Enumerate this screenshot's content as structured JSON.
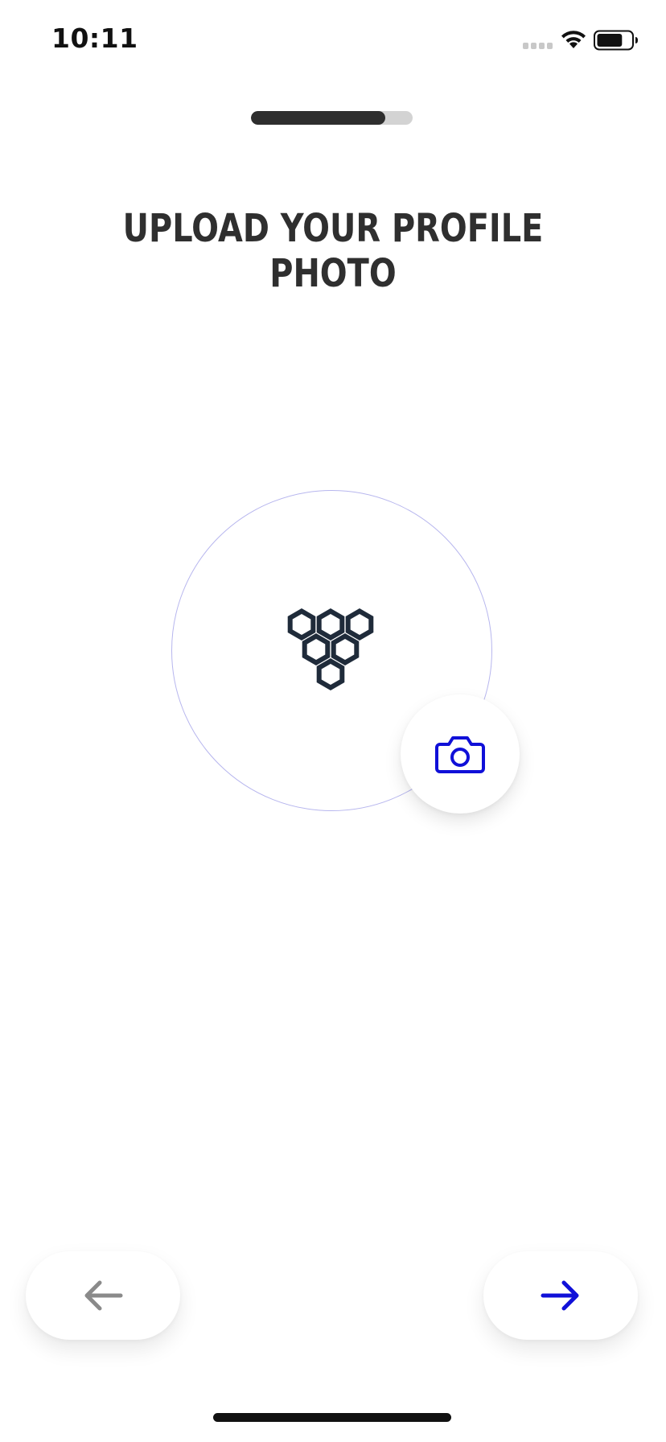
{
  "status_bar": {
    "time": "10:11",
    "signal_icon": "cellular-dots-icon",
    "wifi_icon": "wifi-icon",
    "battery_icon": "battery-icon",
    "battery_level": 0.75
  },
  "progress": {
    "value": 0.83,
    "fill_color": "#2e2e2e",
    "track_color": "#d3d3d3"
  },
  "title": "UPLOAD YOUR PROFILE PHOTO",
  "photo": {
    "placeholder_icon": "honeycomb-logo-icon",
    "camera_icon": "camera-icon"
  },
  "navigation": {
    "back_icon": "arrow-left-icon",
    "next_icon": "arrow-right-icon",
    "back_color": "#8a8a8a",
    "next_color": "#1010d8"
  },
  "colors": {
    "accent": "#1010d8",
    "text": "#2f2f2f",
    "circle_border": "#b7b6ee"
  }
}
